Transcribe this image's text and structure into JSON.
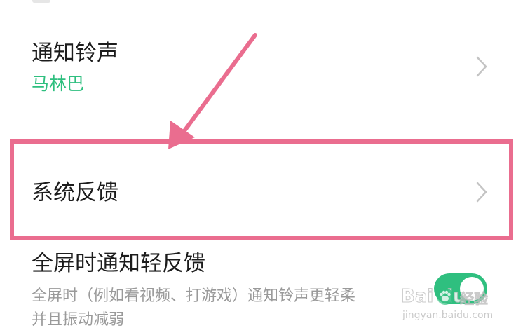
{
  "settings": {
    "notification_ringtone": {
      "title": "通知铃声",
      "value": "马林巴"
    },
    "system_feedback": {
      "title": "系统反馈"
    },
    "fullscreen_light_feedback": {
      "title": "全屏时通知轻反馈",
      "description_line1": "全屏时（例如看视频、打游戏）通知铃声更轻柔",
      "description_line2": "并且振动减弱",
      "enabled": true
    }
  },
  "icons": {
    "chevron": "chevron-right-icon",
    "arrow": "annotation-arrow"
  },
  "colors": {
    "accent_green": "#2fbf7f",
    "highlight": "#ea6d8f",
    "chevron": "#c4c4c4"
  },
  "watermark": {
    "brand": "Bai du",
    "product": "经验",
    "url": "jingyan.baidu.com"
  }
}
